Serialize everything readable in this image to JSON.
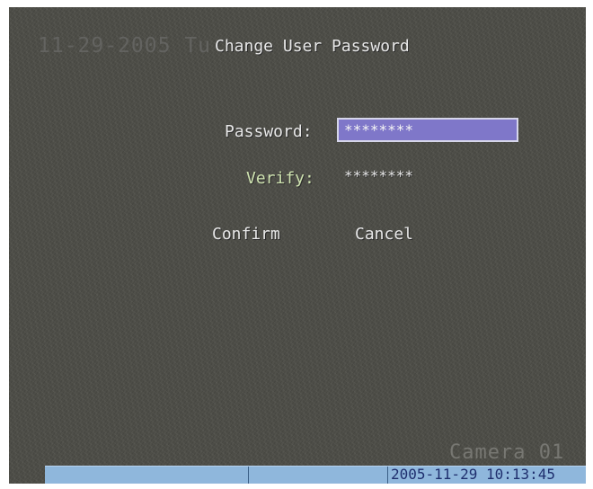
{
  "overlay": {
    "date_text": "11-29-2005 Tu",
    "camera_text": "Camera 01"
  },
  "dialog": {
    "title": "Change User Password",
    "password_label": "Password:",
    "password_value": "********",
    "verify_label": "Verify:",
    "verify_value": "********",
    "confirm_label": "Confirm",
    "cancel_label": "Cancel"
  },
  "status_bar": {
    "datetime": "2005-11-29 10:13:45"
  },
  "colors": {
    "background": "#4d4d47",
    "field_highlight": "#7f77c9",
    "status_bar": "#8fb7dc",
    "status_text": "#1f2f6e"
  }
}
